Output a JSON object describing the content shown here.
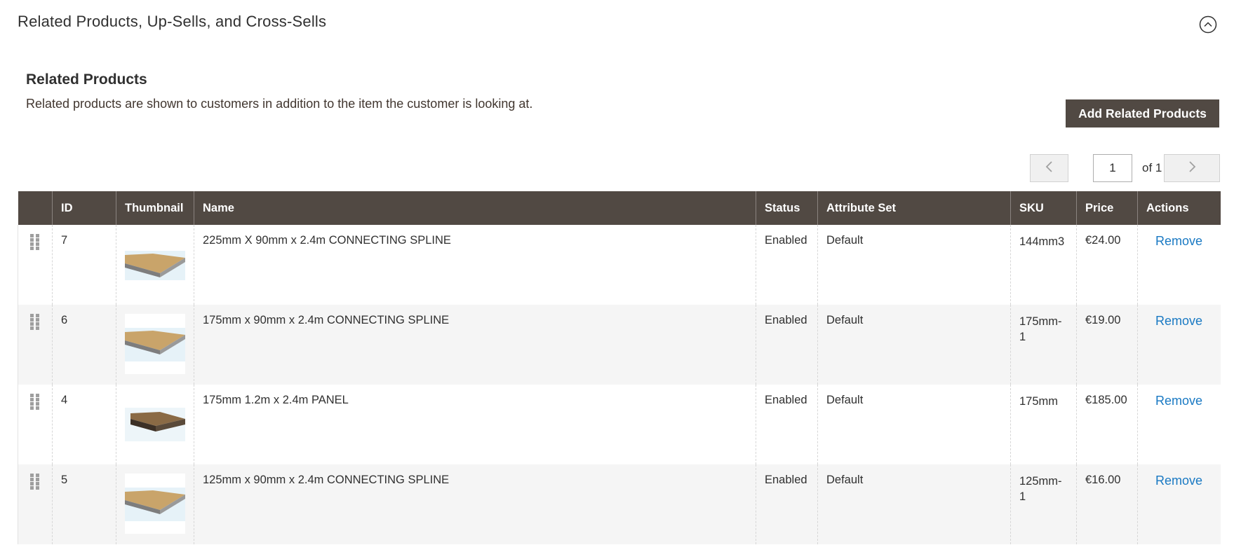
{
  "section": {
    "title": "Related Products, Up-Sells, and Cross-Sells"
  },
  "related": {
    "title": "Related Products",
    "description": "Related products are shown to customers in addition to the item the customer is looking at.",
    "add_button_label": "Add Related Products"
  },
  "pager": {
    "current_page": "1",
    "of_label": "of 1"
  },
  "grid": {
    "columns": [
      "ID",
      "Thumbnail",
      "Name",
      "Status",
      "Attribute Set",
      "SKU",
      "Price",
      "Actions"
    ],
    "rows": [
      {
        "id": "7",
        "name": "225mm X 90mm x 2.4m CONNECTING SPLINE",
        "status": "Enabled",
        "attribute_set": "Default",
        "sku": "144mm3",
        "price": "€24.00",
        "action": "Remove",
        "thumb": "spline"
      },
      {
        "id": "6",
        "name": "175mm x 90mm x 2.4m CONNECTING SPLINE",
        "status": "Enabled",
        "attribute_set": "Default",
        "sku": "175mm-1",
        "price": "€19.00",
        "action": "Remove",
        "thumb": "spline"
      },
      {
        "id": "4",
        "name": "175mm 1.2m x 2.4m PANEL",
        "status": "Enabled",
        "attribute_set": "Default",
        "sku": "175mm",
        "price": "€185.00",
        "action": "Remove",
        "thumb": "panel"
      },
      {
        "id": "5",
        "name": "125mm x 90mm x 2.4m CONNECTING SPLINE",
        "status": "Enabled",
        "attribute_set": "Default",
        "sku": "125mm-1",
        "price": "€16.00",
        "action": "Remove",
        "thumb": "spline"
      }
    ]
  },
  "colors": {
    "header_bg": "#514943",
    "link": "#1979c3",
    "row_alt": "#f5f5f5"
  },
  "icons": {
    "collapse": "chevron-up-circle-icon",
    "prev": "chevron-left-icon",
    "next": "chevron-right-icon",
    "drag": "drag-handle-icon"
  }
}
